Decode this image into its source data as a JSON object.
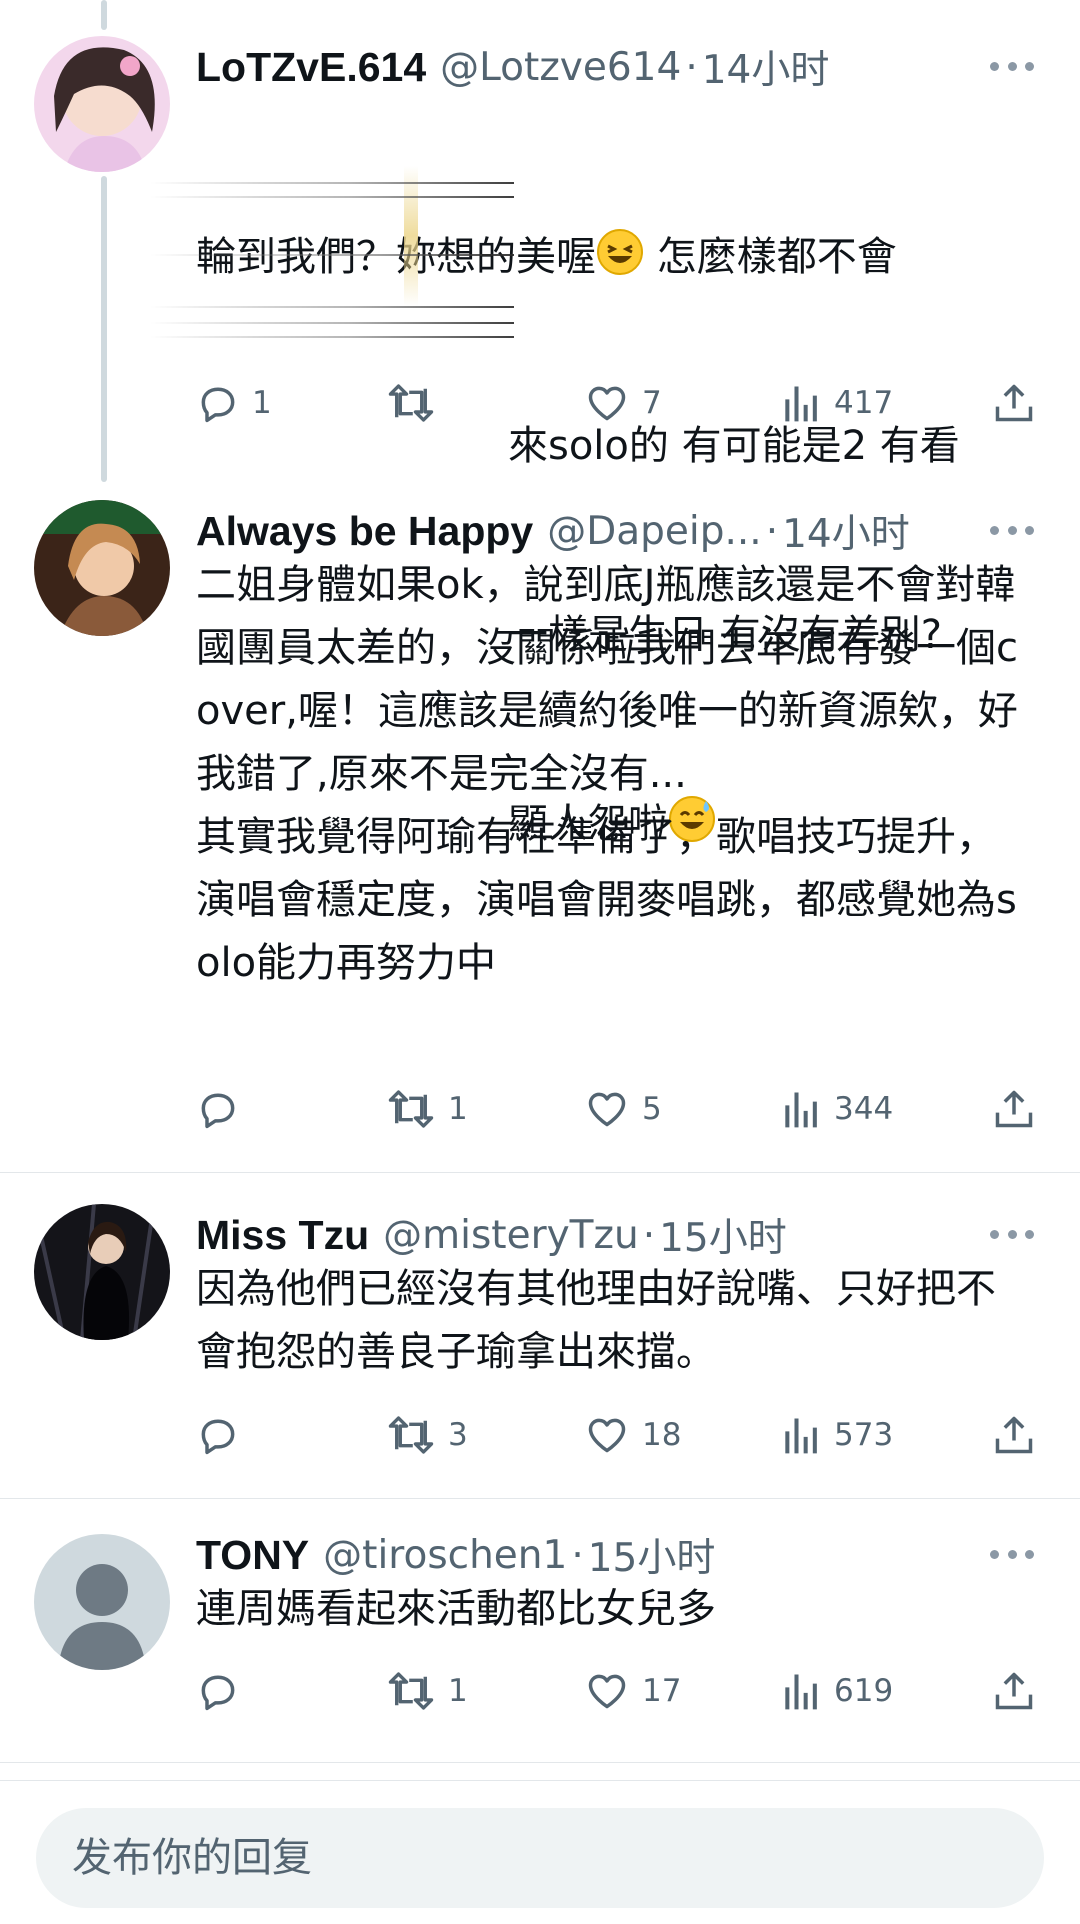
{
  "tweets": [
    {
      "display_name": "LoTZvE.614",
      "handle": "@Lotzve614",
      "time": "14小时",
      "lines": [
        "輪到我們？妳想的美喔",
        " 怎麼樣都不會",
        "來solo的 有可能是2 有看",
        "一樣是生日 有沒有差別?",
        "顯人怨啦"
      ],
      "replies": "1",
      "retweets": "",
      "likes": "7",
      "views": "417",
      "avatar_icon": "user-photo-avatar"
    },
    {
      "display_name": "Always be Happy",
      "handle": "@Dapeip...",
      "time": "14小时",
      "text": "二姐身體如果ok，說到底J瓶應該還是不會對韓國團員太差的，沒關係啦我們去年底有發一個cover,喔！這應該是續約後唯一的新資源欸，好我錯了,原來不是完全沒有...\n其實我覺得阿瑜有在準備了，歌唱技巧提升，演唱會穩定度，演唱會開麥唱跳，都感覺她為solo能力再努力中",
      "replies": "",
      "retweets": "1",
      "likes": "5",
      "views": "344",
      "avatar_icon": "user-photo-avatar"
    },
    {
      "display_name": "Miss Tzu",
      "handle": "@misteryTzu",
      "time": "15小时",
      "text": "因為他們已經沒有其他理由好說嘴、只好把不會抱怨的善良子瑜拿出來擋。",
      "replies": "",
      "retweets": "3",
      "likes": "18",
      "views": "573",
      "avatar_icon": "user-photo-avatar"
    },
    {
      "display_name": "TONY",
      "handle": "@tiroschen1",
      "time": "15小时",
      "text": "連周媽看起來活動都比女兒多",
      "replies": "",
      "retweets": "1",
      "likes": "17",
      "views": "619",
      "avatar_icon": "default-person-avatar"
    }
  ],
  "header_separator": "·",
  "reply_bar": {
    "placeholder": "发布你的回复"
  },
  "icons": {
    "reply": "reply-icon",
    "retweet": "retweet-icon",
    "like": "heart-icon",
    "views": "views-icon",
    "share": "share-icon",
    "more": "more-icon"
  },
  "colors": {
    "text": "#0f1419",
    "secondary": "#536471",
    "thread_line": "#cfd9de",
    "reply_bar_bg": "#eff3f4"
  }
}
